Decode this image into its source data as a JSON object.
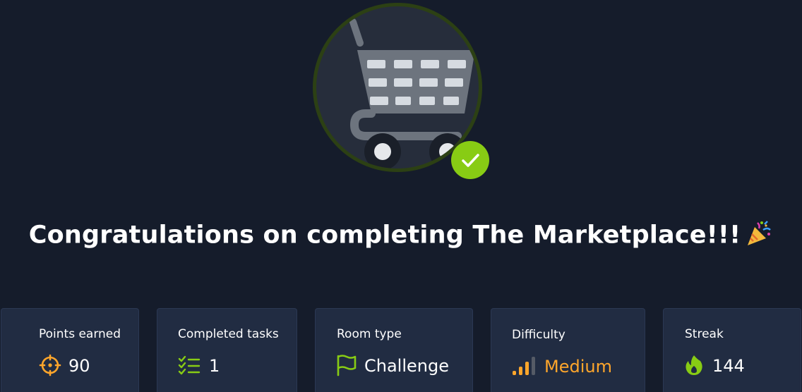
{
  "title": "Congratulations on completing The Marketplace!!!",
  "room_icon": "shopping-cart-icon",
  "completed_icon": "check-icon",
  "colors": {
    "background": "#151c2b",
    "card": "#212c42",
    "accent_green": "#88cc14",
    "points_icon": "#ffa62b",
    "difficulty_medium": "#ffa62b"
  },
  "stats": [
    {
      "label": "Points earned",
      "value": "90",
      "icon": "target-icon"
    },
    {
      "label": "Completed tasks",
      "value": "1",
      "icon": "task-list-icon"
    },
    {
      "label": "Room type",
      "value": "Challenge",
      "icon": "flag-icon"
    },
    {
      "label": "Difficulty",
      "value": "Medium",
      "icon": "signal-bars-icon"
    },
    {
      "label": "Streak",
      "value": "144",
      "icon": "flame-icon"
    }
  ]
}
